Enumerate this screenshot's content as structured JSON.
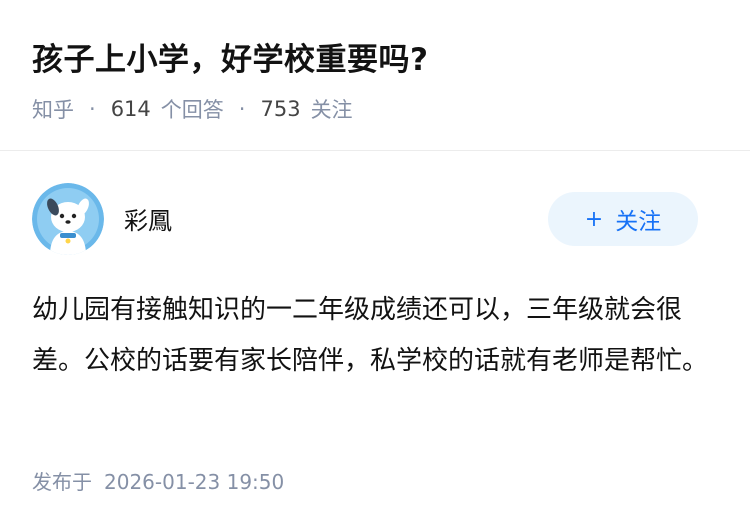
{
  "question": {
    "title": "孩子上小学，好学校重要吗?",
    "source": "知乎",
    "answer_count": "614",
    "answer_label": "个回答",
    "follower_count": "753",
    "follower_label": "关注",
    "separator": "·"
  },
  "answer": {
    "author_name": "彩鳳",
    "follow_label": "关注",
    "follow_icon": "plus-icon",
    "avatar_icon": "cartoon-dog-avatar",
    "body": "幼儿园有接触知识的一二年级成绩还可以，三年级就会很差。公校的话要有家长陪伴，私学校的话就有老师是帮忙。",
    "publish_label": "发布于",
    "publish_time": "2026-01-23 19:50"
  },
  "colors": {
    "accent": "#1772f6",
    "accent_bg": "#ebf5fd",
    "meta": "#8590a6",
    "avatar_bg": "#6ab8ea"
  }
}
